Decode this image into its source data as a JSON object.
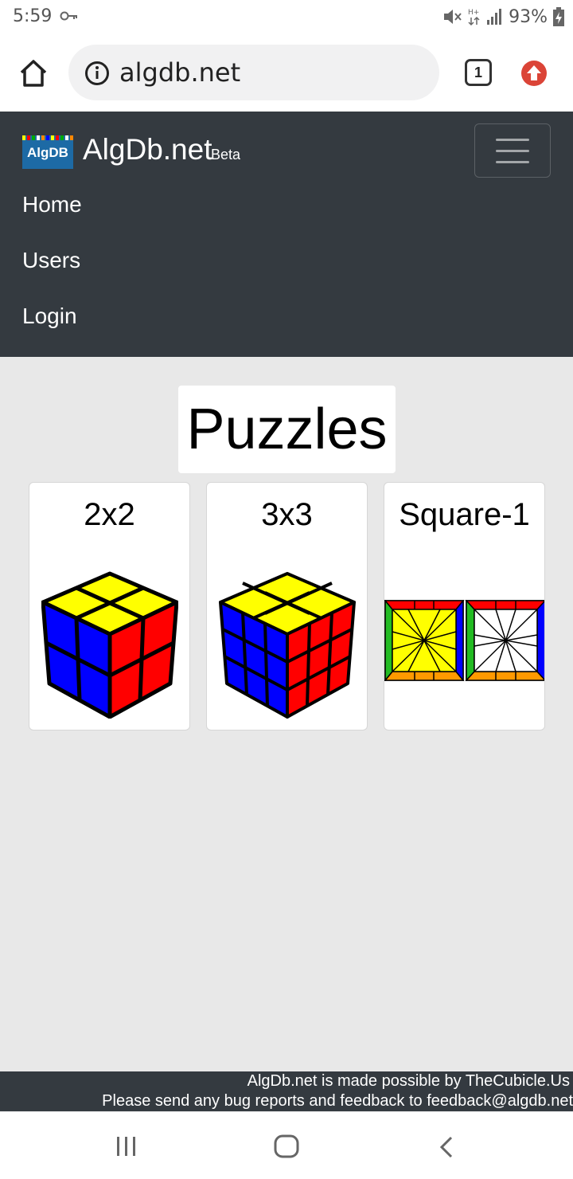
{
  "status_bar": {
    "time": "5:59",
    "battery": "93%",
    "icons": [
      "key-icon",
      "mute-icon",
      "data-icon",
      "signal-icon",
      "battery-charging-icon"
    ]
  },
  "browser": {
    "url": "algdb.net",
    "tab_count": "1",
    "icons": [
      "home-icon",
      "info-icon",
      "tabs-icon",
      "update-icon"
    ]
  },
  "navbar": {
    "brand_logo_text": "AlgDB",
    "brand_name": "AlgDb.net",
    "brand_badge": "Beta",
    "links": [
      "Home",
      "Users",
      "Login"
    ],
    "bg_color": "#343a40"
  },
  "main": {
    "heading": "Puzzles",
    "puzzles": [
      {
        "name": "2x2",
        "image": "2x2-cube-icon"
      },
      {
        "name": "3x3",
        "image": "3x3-cube-icon"
      },
      {
        "name": "Square-1",
        "image": "square-1-icon"
      }
    ]
  },
  "footer": {
    "line1": "AlgDb.net is made possible by TheCubicle.Us",
    "line2": "Please send any bug reports and feedback to feedback@algdb.net"
  },
  "colors": {
    "cube_yellow": "#ffff00",
    "cube_red": "#ff0000",
    "cube_blue": "#0000ff",
    "sq1_green": "#22bb22",
    "sq1_orange": "#ff9900",
    "update_red": "#db4437"
  }
}
